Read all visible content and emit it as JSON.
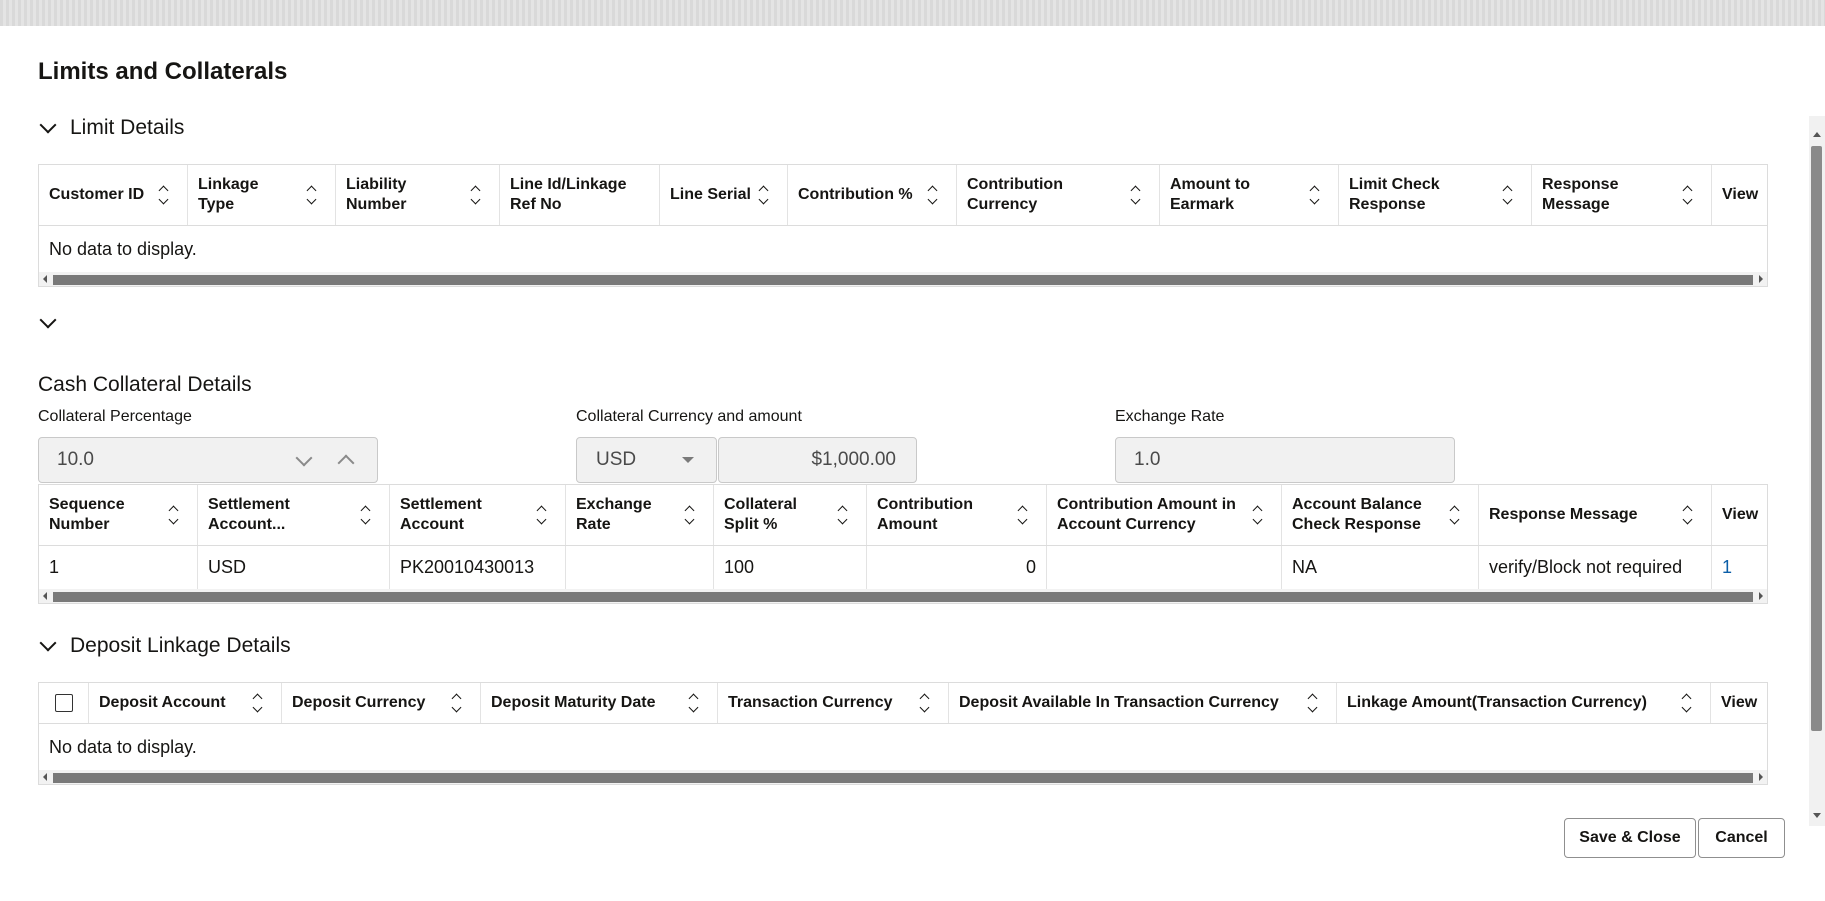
{
  "dialog": {
    "title": "Limits and Collaterals"
  },
  "limit_details": {
    "title": "Limit Details",
    "columns": [
      "Customer ID",
      "Linkage Type",
      "Liability Number",
      "Line Id/Linkage Ref No",
      "Line Serial",
      "Contribution %",
      "Contribution Currency",
      "Amount to Earmark",
      "Limit Check Response",
      "Response Message",
      "View"
    ],
    "empty_text": "No data to display."
  },
  "cash_collateral": {
    "title": "Cash Collateral Details",
    "collateral_percentage": {
      "label": "Collateral Percentage",
      "value": "10.0"
    },
    "collateral_currency_amount": {
      "label": "Collateral Currency and amount",
      "currency": "USD",
      "amount": "$1,000.00"
    },
    "exchange_rate": {
      "label": "Exchange Rate",
      "value": "1.0"
    },
    "columns": [
      "Sequence Number",
      "Settlement Account...",
      "Settlement Account",
      "Exchange Rate",
      "Collateral Split %",
      "Contribution Amount",
      "Contribution Amount in Account Currency",
      "Account Balance Check Response",
      "Response Message",
      "View"
    ],
    "rows": [
      {
        "sequence_number": "1",
        "settlement_account_currency": "USD",
        "settlement_account": "PK20010430013",
        "exchange_rate": "",
        "collateral_split": "100",
        "contribution_amount": "0",
        "contribution_amount_account_ccy": "",
        "account_balance_check_response": "NA",
        "response_message": "verify/Block not required",
        "view": "1"
      }
    ]
  },
  "deposit_linkage": {
    "title": "Deposit Linkage Details",
    "columns": [
      "Deposit Account",
      "Deposit Currency",
      "Deposit Maturity Date",
      "Transaction Currency",
      "Deposit Available In Transaction Currency",
      "Linkage Amount(Transaction Currency)",
      "View"
    ],
    "empty_text": "No data to display."
  },
  "footer": {
    "save_close": "Save & Close",
    "cancel": "Cancel"
  }
}
